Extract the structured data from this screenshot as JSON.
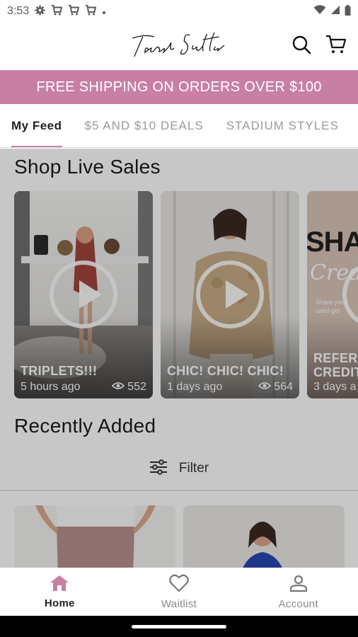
{
  "status_bar": {
    "time": "3:53",
    "icons": [
      "gear-icon",
      "cart-notification-icon",
      "cart-notification-icon",
      "cart-notification-icon",
      "dot-icon"
    ],
    "right_icons": [
      "wifi-icon",
      "signal-icon",
      "battery-icon"
    ]
  },
  "header": {
    "logo_text": "Tasah Sutton",
    "icons": [
      "search-icon",
      "cart-icon"
    ]
  },
  "promo": {
    "text": "FREE SHIPPING ON ORDERS OVER $100",
    "color": "#c87fa4"
  },
  "tabs": [
    {
      "label": "My Feed",
      "active": true
    },
    {
      "label": "$5 AND $10 DEALS",
      "active": false
    },
    {
      "label": "STADIUM STYLES",
      "active": false
    }
  ],
  "live_sales": {
    "title": "Shop Live Sales",
    "cards": [
      {
        "title": "TRIPLETS!!!",
        "time": "5 hours ago",
        "views": "552"
      },
      {
        "title": "CHIC! CHIC! CHIC!",
        "time": "1 days ago",
        "views": "564"
      },
      {
        "title": "REFER",
        "title2": "CREDIT",
        "time": "3 days a",
        "overlay_text": "SHARE",
        "overlay_script": "Credi",
        "overlay_small": "Share you",
        "overlay_small2": "used get"
      }
    ]
  },
  "recently_added": {
    "title": "Recently Added",
    "filter_label": "Filter"
  },
  "bottom_nav": [
    {
      "label": "Home",
      "icon": "home-icon",
      "active": true
    },
    {
      "label": "Waitlist",
      "icon": "heart-icon",
      "active": false
    },
    {
      "label": "Account",
      "icon": "account-icon",
      "active": false
    }
  ],
  "colors": {
    "accent": "#c87fa4"
  }
}
